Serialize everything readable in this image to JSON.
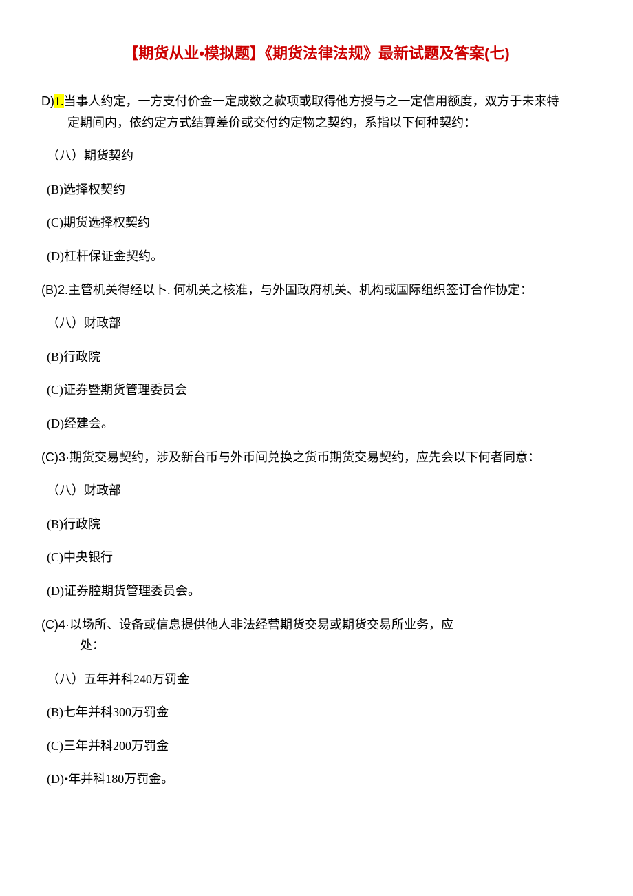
{
  "title": "【期货从业•模拟题】《期货法律法规》最新试题及答案(七)",
  "questions": [
    {
      "prefix": "D)",
      "number": "1.",
      "stem_line1": "当事人约定，一方支付价金一定成数之款项或取得他方授与之一定信用额度，双方于未来特",
      "stem_line2": "定期间内，依约定方式结算差价或交付约定物之契约，系指以下何种契约：",
      "options": [
        "（八）期货契约",
        "(B)选择权契约",
        "(C)期货选择权契约",
        "(D)杠杆保证金契约。"
      ]
    },
    {
      "prefix": "(B)2.",
      "stem": "主管机关得经以卜. 何机关之核准，与外国政府机关、机构或国际组织签订合作协定：",
      "options": [
        "（八）财政部",
        "(B)行政院",
        "(C)证券暨期货管理委员会",
        "(D)经建会。"
      ]
    },
    {
      "prefix": "(C)3·",
      "stem": "期货交易契约，涉及新台币与外币间兑换之货币期货交易契约，应先会以下何者同意：",
      "options": [
        "（八）财政部",
        "(B)行政院",
        "(C)中央银行",
        "(D)证券腔期货管理委员会。"
      ]
    },
    {
      "prefix": "(C)4·",
      "stem_line1": "以场所、设备或信息提供他人非法经营期货交易或期货交易所业务，应",
      "stem_line2": "处：",
      "options": [
        "（八）五年并科240万罚金",
        "(B)七年并科300万罚金",
        "(C)三年并科200万罚金",
        "(D)•年并科180万罚金。"
      ]
    }
  ]
}
